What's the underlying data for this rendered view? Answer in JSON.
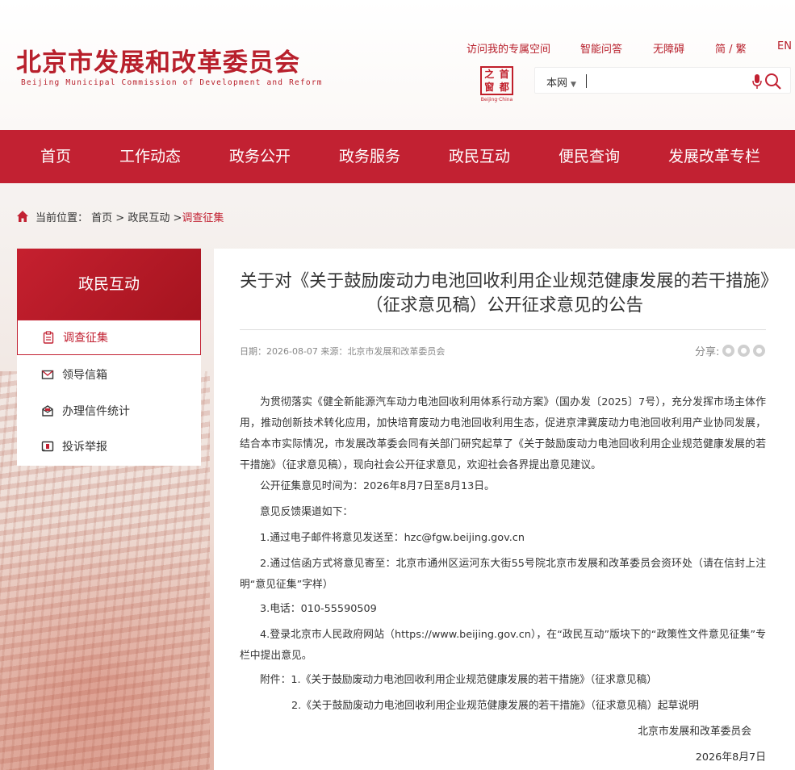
{
  "header": {
    "title_cn": "北京市发展和改革委员会",
    "title_en": "Beijing Municipal Commission of Development and Reform",
    "links": [
      "访问我的专属空间",
      "智能问答",
      "无障碍",
      "简 / 繁",
      "EN"
    ],
    "seal": {
      "chars": [
        "之",
        "首",
        "窗",
        "都"
      ],
      "sub": "Beijing·China"
    },
    "search": {
      "scope": "本网",
      "placeholder": ""
    },
    "accent": "#c22132"
  },
  "nav": {
    "items": [
      "首页",
      "工作动态",
      "政务公开",
      "政务服务",
      "政民互动",
      "便民查询",
      "发展改革专栏"
    ]
  },
  "breadcrumb": {
    "label": "当前位置：",
    "path": "首页 > 政民互动 > ",
    "current": "调查征集"
  },
  "sidebar": {
    "title": "政民互动",
    "items": [
      {
        "label": "调查征集",
        "icon": "clipboard-icon",
        "active": true
      },
      {
        "label": "领导信箱",
        "icon": "mail-icon",
        "active": false
      },
      {
        "label": "办理信件统计",
        "icon": "mail-stats-icon",
        "active": false
      },
      {
        "label": "投诉举报",
        "icon": "report-icon",
        "active": false
      }
    ]
  },
  "article": {
    "title": "关于对《关于鼓励废动力电池回收利用企业规范健康发展的若干措施》（征求意见稿）公开征求意见的公告",
    "meta": "日期：2026-08-07   来源：北京市发展和改革委员会",
    "share_label": "分享:",
    "paragraphs": [
      "为贯彻落实《健全新能源汽车动力电池回收利用体系行动方案》（国办发〔2025〕7号），充分发挥市场主体作用，推动创新技术转化应用，加快培育废动力电池回收利用生态，促进京津冀废动力电池回收利用产业协同发展，结合本市实际情况，市发展改革委会同有关部门研究起草了《关于鼓励废动力电池回收利用企业规范健康发展的若干措施》（征求意见稿），现向社会公开征求意见，欢迎社会各界提出意见建议。",
      "公开征集意见时间为：2026年8月7日至8月13日。",
      "意见反馈渠道如下：",
      "1.通过电子邮件将意见发送至：hzc@fgw.beijing.gov.cn",
      "2.通过信函方式将意见寄至：北京市通州区运河东大街55号院北京市发展和改革委员会资环处（请在信封上注明“意见征集”字样）",
      "3.电话：010-55590509",
      "4.登录北京市人民政府网站（https://www.beijing.gov.cn），在“政民互动”版块下的“政策性文件意见征集”专栏中提出意见。",
      "附件：1.《关于鼓励废动力电池回收利用企业规范健康发展的若干措施》（征求意见稿）",
      "2.《关于鼓励废动力电池回收利用企业规范健康发展的若干措施》（征求意见稿）起草说明"
    ],
    "signature": "北京市发展和改革委员会",
    "date": "2026年8月7日"
  }
}
